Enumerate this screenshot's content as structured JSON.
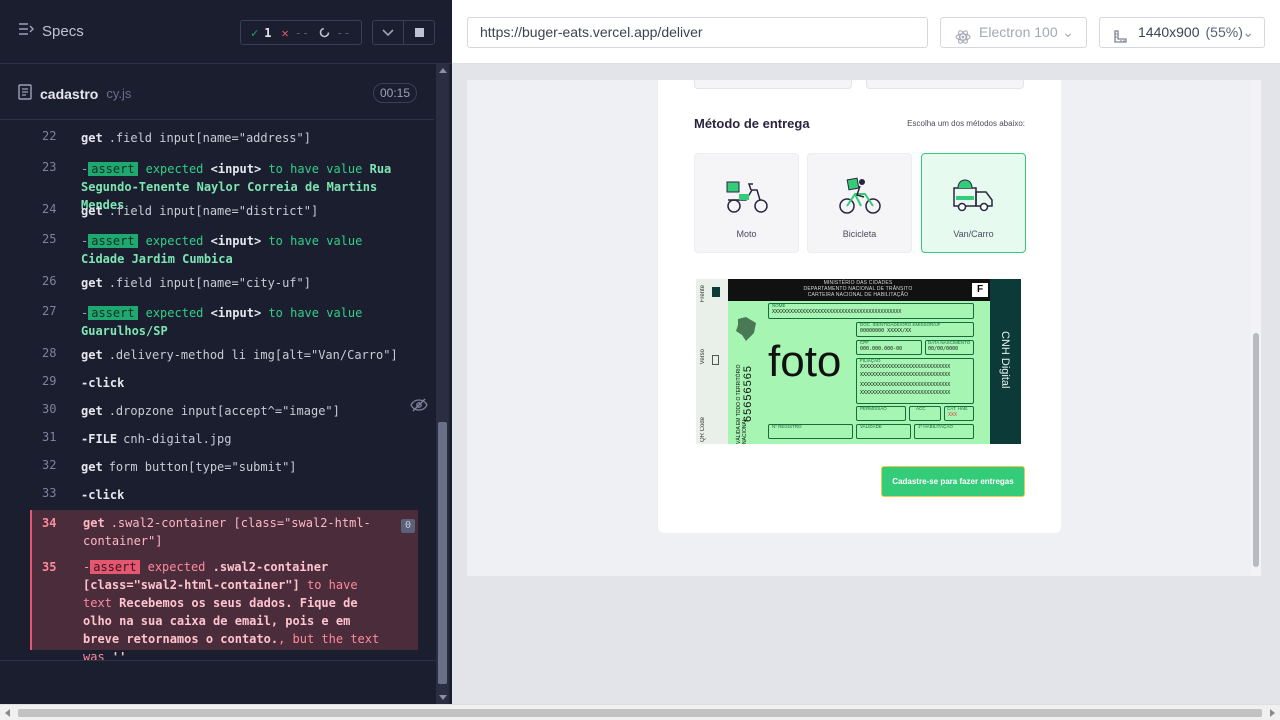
{
  "reporter": {
    "title": "Specs",
    "stats": {
      "passed": "1",
      "failed": "--",
      "pending": "--"
    },
    "spec_file": {
      "name": "cadastro",
      "ext": "cy.js",
      "duration": "00:15"
    }
  },
  "commands": [
    {
      "n": "22",
      "kw": "get",
      "sel": ".field input[name=\"address\"]"
    },
    {
      "n": "23",
      "assert": true,
      "expected": "expected",
      "subject": "<input>",
      "mid": "to have value",
      "value": "Rua Segundo-Tenente Naylor Correia de Martins Mendes"
    },
    {
      "n": "24",
      "kw": "get",
      "sel": ".field input[name=\"district\"]"
    },
    {
      "n": "25",
      "assert": true,
      "expected": "expected",
      "subject": "<input>",
      "mid": "to have value",
      "value": "Cidade Jardim Cumbica"
    },
    {
      "n": "26",
      "kw": "get",
      "sel": ".field input[name=\"city-uf\"]"
    },
    {
      "n": "27",
      "assert": true,
      "expected": "expected",
      "subject": "<input>",
      "mid": "to have value",
      "value": "Guarulhos/SP"
    },
    {
      "n": "28",
      "kw": "get",
      "sel": ".delivery-method li img[alt=\"Van/Carro\"]"
    },
    {
      "n": "29",
      "kw": "-click",
      "sel": ""
    },
    {
      "n": "30",
      "kw": "get",
      "sel": ".dropzone input[accept^=\"image\"]"
    },
    {
      "n": "31",
      "kw": "-FILE",
      "sel": "cnh-digital.jpg"
    },
    {
      "n": "32",
      "kw": "get",
      "sel": "form button[type=\"submit\"]"
    },
    {
      "n": "33",
      "kw": "-click",
      "sel": ""
    }
  ],
  "failed": {
    "cmd34": {
      "n": "34",
      "kw": "get",
      "sel": ".swal2-container [class=\"swal2-html-container\"]",
      "count": "0"
    },
    "cmd35": {
      "n": "35",
      "badge": "assert",
      "expected": "expected",
      "subject": ".swal2-container [class=\"swal2-html-container\"]",
      "mid": "to have text",
      "value": "Recebemos os seus dados. Fique de olho na sua caixa de email, pois e em breve retornamos o contato.",
      "tail": ", but the text was",
      "actual": "''"
    }
  },
  "assert_label": "assert",
  "browser": {
    "url": "https://buger-eats.vercel.app/deliver",
    "engine": "Electron 100",
    "viewport": "1440x900",
    "zoom": "(55%)"
  },
  "app": {
    "section_title": "Método de entrega",
    "section_hint": "Escolha um dos métodos abaixo:",
    "methods": [
      {
        "label": "Moto",
        "selected": false
      },
      {
        "label": "Bicicleta",
        "selected": false
      },
      {
        "label": "Van/Carro",
        "selected": true
      }
    ],
    "cnh": {
      "header_1": "MINISTÉRIO DAS CIDADES",
      "header_2": "DEPARTAMENTO NACIONAL DE TRÂNSITO",
      "header_3": "CARTEIRA NACIONAL DE HABILITAÇÃO",
      "cat": "F",
      "side_label": "CNH Digital",
      "photo": "foto",
      "number": "65656565",
      "side_left_1": "Frente",
      "side_left_2": "Verso",
      "side_left_3": "QR Code",
      "vert_note": "VÁLIDA EM TODO O TERRITÓRIO NACIONAL",
      "nome": "NOME",
      "nome_v": "XXXXXXXXXXXXXXXXXXXXXXXXXXXXXXXXXXXXXXXXXXX",
      "doc": "DOC. IDENTIDADE/ÓRG EMISSOR/UF",
      "doc_v": "00000000 XXXXX/XX",
      "cpf": "CPF",
      "cpf_v": "000.000.000-00",
      "nasc": "DATA NASCIMENTO",
      "nasc_v": "00/00/0000",
      "filiacao": "FILIAÇÃO",
      "filiacao_v": "XXXXXXXXXXXXXXXXXXXXXXXXXXXXXX",
      "permissao": "PERMISSÃO",
      "acc": "ACC",
      "cathab": "CAT. HAB.",
      "cat_v": "XXX",
      "registro": "Nº REGISTRO",
      "validade": "VALIDADE",
      "primeira": "1ª HABILITAÇÃO"
    },
    "submit_label": "Cadastre-se para fazer entregas"
  }
}
